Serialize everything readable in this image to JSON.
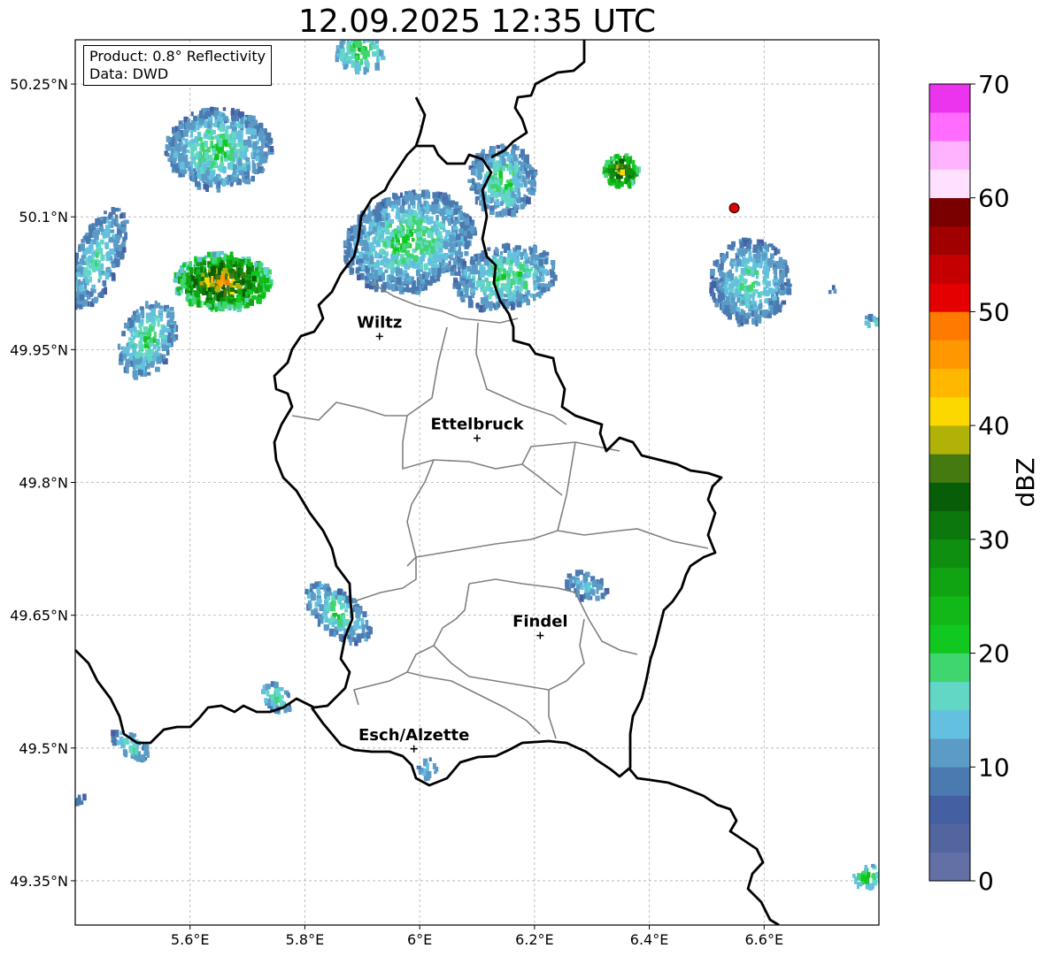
{
  "title": "12.09.2025 12:35 UTC",
  "info": {
    "product": "Product: 0.8° Reflectivity",
    "data": "Data: DWD"
  },
  "map": {
    "lon_range": [
      5.4,
      6.8
    ],
    "lat_range": [
      49.3,
      50.3
    ],
    "lon_ticks": [
      {
        "value": 5.6,
        "label": "5.6°E"
      },
      {
        "value": 5.8,
        "label": "5.8°E"
      },
      {
        "value": 6.0,
        "label": "6°E"
      },
      {
        "value": 6.2,
        "label": "6.2°E"
      },
      {
        "value": 6.4,
        "label": "6.4°E"
      },
      {
        "value": 6.6,
        "label": "6.6°E"
      }
    ],
    "lat_ticks": [
      {
        "value": 49.35,
        "label": "49.35°N"
      },
      {
        "value": 49.5,
        "label": "49.5°N"
      },
      {
        "value": 49.65,
        "label": "49.65°N"
      },
      {
        "value": 49.8,
        "label": "49.8°N"
      },
      {
        "value": 49.95,
        "label": "49.95°N"
      },
      {
        "value": 50.1,
        "label": "50.1°N"
      },
      {
        "value": 50.25,
        "label": "50.25°N"
      }
    ],
    "cities": [
      {
        "name": "Wiltz",
        "lon": 5.93,
        "lat": 49.965
      },
      {
        "name": "Ettelbruck",
        "lon": 6.1,
        "lat": 49.85
      },
      {
        "name": "Findel",
        "lon": 6.21,
        "lat": 49.627
      },
      {
        "name": "Esch/Alzette",
        "lon": 5.99,
        "lat": 49.499
      }
    ],
    "radar_site": {
      "lon": 6.548,
      "lat": 50.11,
      "color": "#e00000"
    }
  },
  "colorbar": {
    "label": "dBZ",
    "min": 0,
    "max": 70,
    "tick_labels": [
      "0",
      "10",
      "20",
      "30",
      "40",
      "50",
      "60",
      "70"
    ],
    "colors": [
      "#6270a6",
      "#53659f",
      "#4560a2",
      "#4b7ab1",
      "#5b9bc6",
      "#63c0de",
      "#63d7c6",
      "#3fd56f",
      "#10c820",
      "#12b818",
      "#11a412",
      "#0f8f10",
      "#0c770c",
      "#085e08",
      "#457a10",
      "#b0b207",
      "#fdd800",
      "#ffb700",
      "#ff9800",
      "#ff7b00",
      "#e40000",
      "#c40000",
      "#a00000",
      "#7a0000",
      "#ffe0ff",
      "#ffb3ff",
      "#ff6cff",
      "#ea34ee"
    ]
  }
}
